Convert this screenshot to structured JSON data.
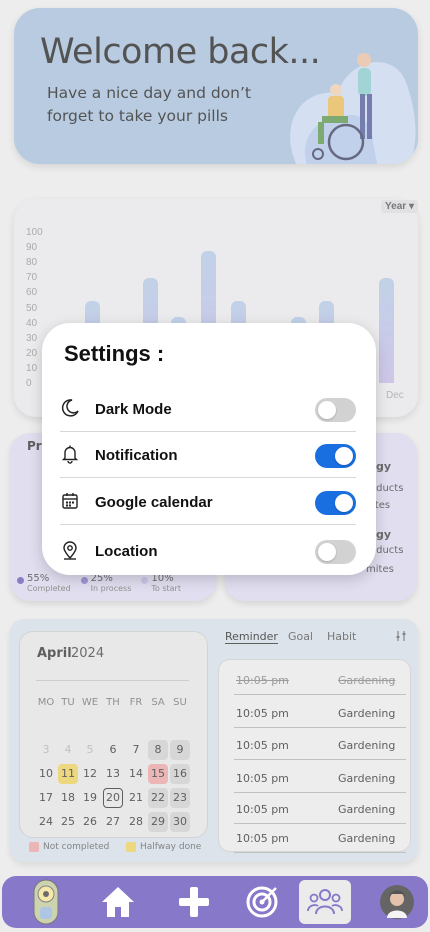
{
  "hero": {
    "title": "Welcome back...",
    "subtitle": "Have a nice day and don’t forget to take your pills"
  },
  "chart": {
    "period_select": "Year",
    "y_ticks": [
      "100",
      "90",
      "80",
      "70",
      "60",
      "50",
      "40",
      "30",
      "20",
      "10",
      "0"
    ],
    "x_last_label": "Dec"
  },
  "chart_data": {
    "type": "bar",
    "categories": [
      "",
      "",
      "",
      "",
      "",
      "",
      "",
      "",
      "",
      "",
      "",
      "Dec"
    ],
    "values": [
      10,
      55,
      10,
      70,
      44,
      88,
      55,
      10,
      44,
      55,
      10,
      70
    ],
    "ylim": [
      0,
      100
    ],
    "grid": false
  },
  "progress_card": {
    "title": "Pr",
    "stats": [
      {
        "value": "55%",
        "label": "Completed",
        "color": "#5b4db0"
      },
      {
        "value": "25%",
        "label": "In process",
        "color": "#7b6cc7"
      },
      {
        "value": "10%",
        "label": "To start",
        "color": "#b8b0e0"
      }
    ]
  },
  "allergy_card": {
    "lines": [
      "gy",
      "oducts",
      "ites",
      "gy",
      "oducts",
      "mites"
    ]
  },
  "calendar": {
    "month": "April",
    "year": "2024",
    "weekdays": [
      "MO",
      "TU",
      "WE",
      "TH",
      "FR",
      "SA",
      "SU"
    ],
    "days": [
      {
        "d": "3",
        "s": "faded"
      },
      {
        "d": "4",
        "s": "faded"
      },
      {
        "d": "5",
        "s": "faded"
      },
      {
        "d": "6",
        "s": ""
      },
      {
        "d": "7",
        "s": ""
      },
      {
        "d": "8",
        "s": "gray"
      },
      {
        "d": "9",
        "s": "gray"
      },
      {
        "d": "10",
        "s": ""
      },
      {
        "d": "11",
        "s": "yellow"
      },
      {
        "d": "12",
        "s": ""
      },
      {
        "d": "13",
        "s": ""
      },
      {
        "d": "14",
        "s": ""
      },
      {
        "d": "15",
        "s": "red"
      },
      {
        "d": "16",
        "s": "gray"
      },
      {
        "d": "17",
        "s": ""
      },
      {
        "d": "18",
        "s": ""
      },
      {
        "d": "19",
        "s": ""
      },
      {
        "d": "20",
        "s": "today"
      },
      {
        "d": "21",
        "s": ""
      },
      {
        "d": "22",
        "s": "gray"
      },
      {
        "d": "23",
        "s": "gray"
      },
      {
        "d": "24",
        "s": ""
      },
      {
        "d": "25",
        "s": ""
      },
      {
        "d": "26",
        "s": ""
      },
      {
        "d": "27",
        "s": ""
      },
      {
        "d": "28",
        "s": ""
      },
      {
        "d": "29",
        "s": "gray"
      },
      {
        "d": "30",
        "s": "gray"
      }
    ],
    "legend": [
      {
        "label": "Not completed",
        "color": "#e59a9a"
      },
      {
        "label": "Halfway done",
        "color": "#e6c84e"
      }
    ]
  },
  "reminders": {
    "tabs": [
      "Reminder",
      "Goal",
      "Habit"
    ],
    "items": [
      {
        "time": "10:05 pm",
        "name": "Gardening",
        "done": true
      },
      {
        "time": "10:05  pm",
        "name": "Gardening",
        "done": false
      },
      {
        "time": "10:05  pm",
        "name": "Gardening",
        "done": false
      },
      {
        "time": "10:05  pm",
        "name": "Gardening",
        "done": false
      },
      {
        "time": "10:05  pm",
        "name": "Gardening",
        "done": false
      },
      {
        "time": "10:05  pm",
        "name": "Gardening",
        "done": false
      }
    ]
  },
  "nav": {
    "items": [
      "profile-toggle",
      "home-icon",
      "add-icon",
      "target-icon",
      "people-icon",
      "avatar"
    ]
  },
  "settings": {
    "title": "Settings :",
    "items": [
      {
        "label": "Dark Mode",
        "icon": "moon-icon",
        "on": false
      },
      {
        "label": "Notification",
        "icon": "bell-icon",
        "on": true
      },
      {
        "label": "Google calendar",
        "icon": "calendar-icon",
        "on": true
      },
      {
        "label": "Location",
        "icon": "location-pin-icon",
        "on": false
      }
    ]
  },
  "colors": {
    "accent": "#5a44b4",
    "toggle_on": "#1a6fe0",
    "hero_bg": "#9db7d6"
  }
}
